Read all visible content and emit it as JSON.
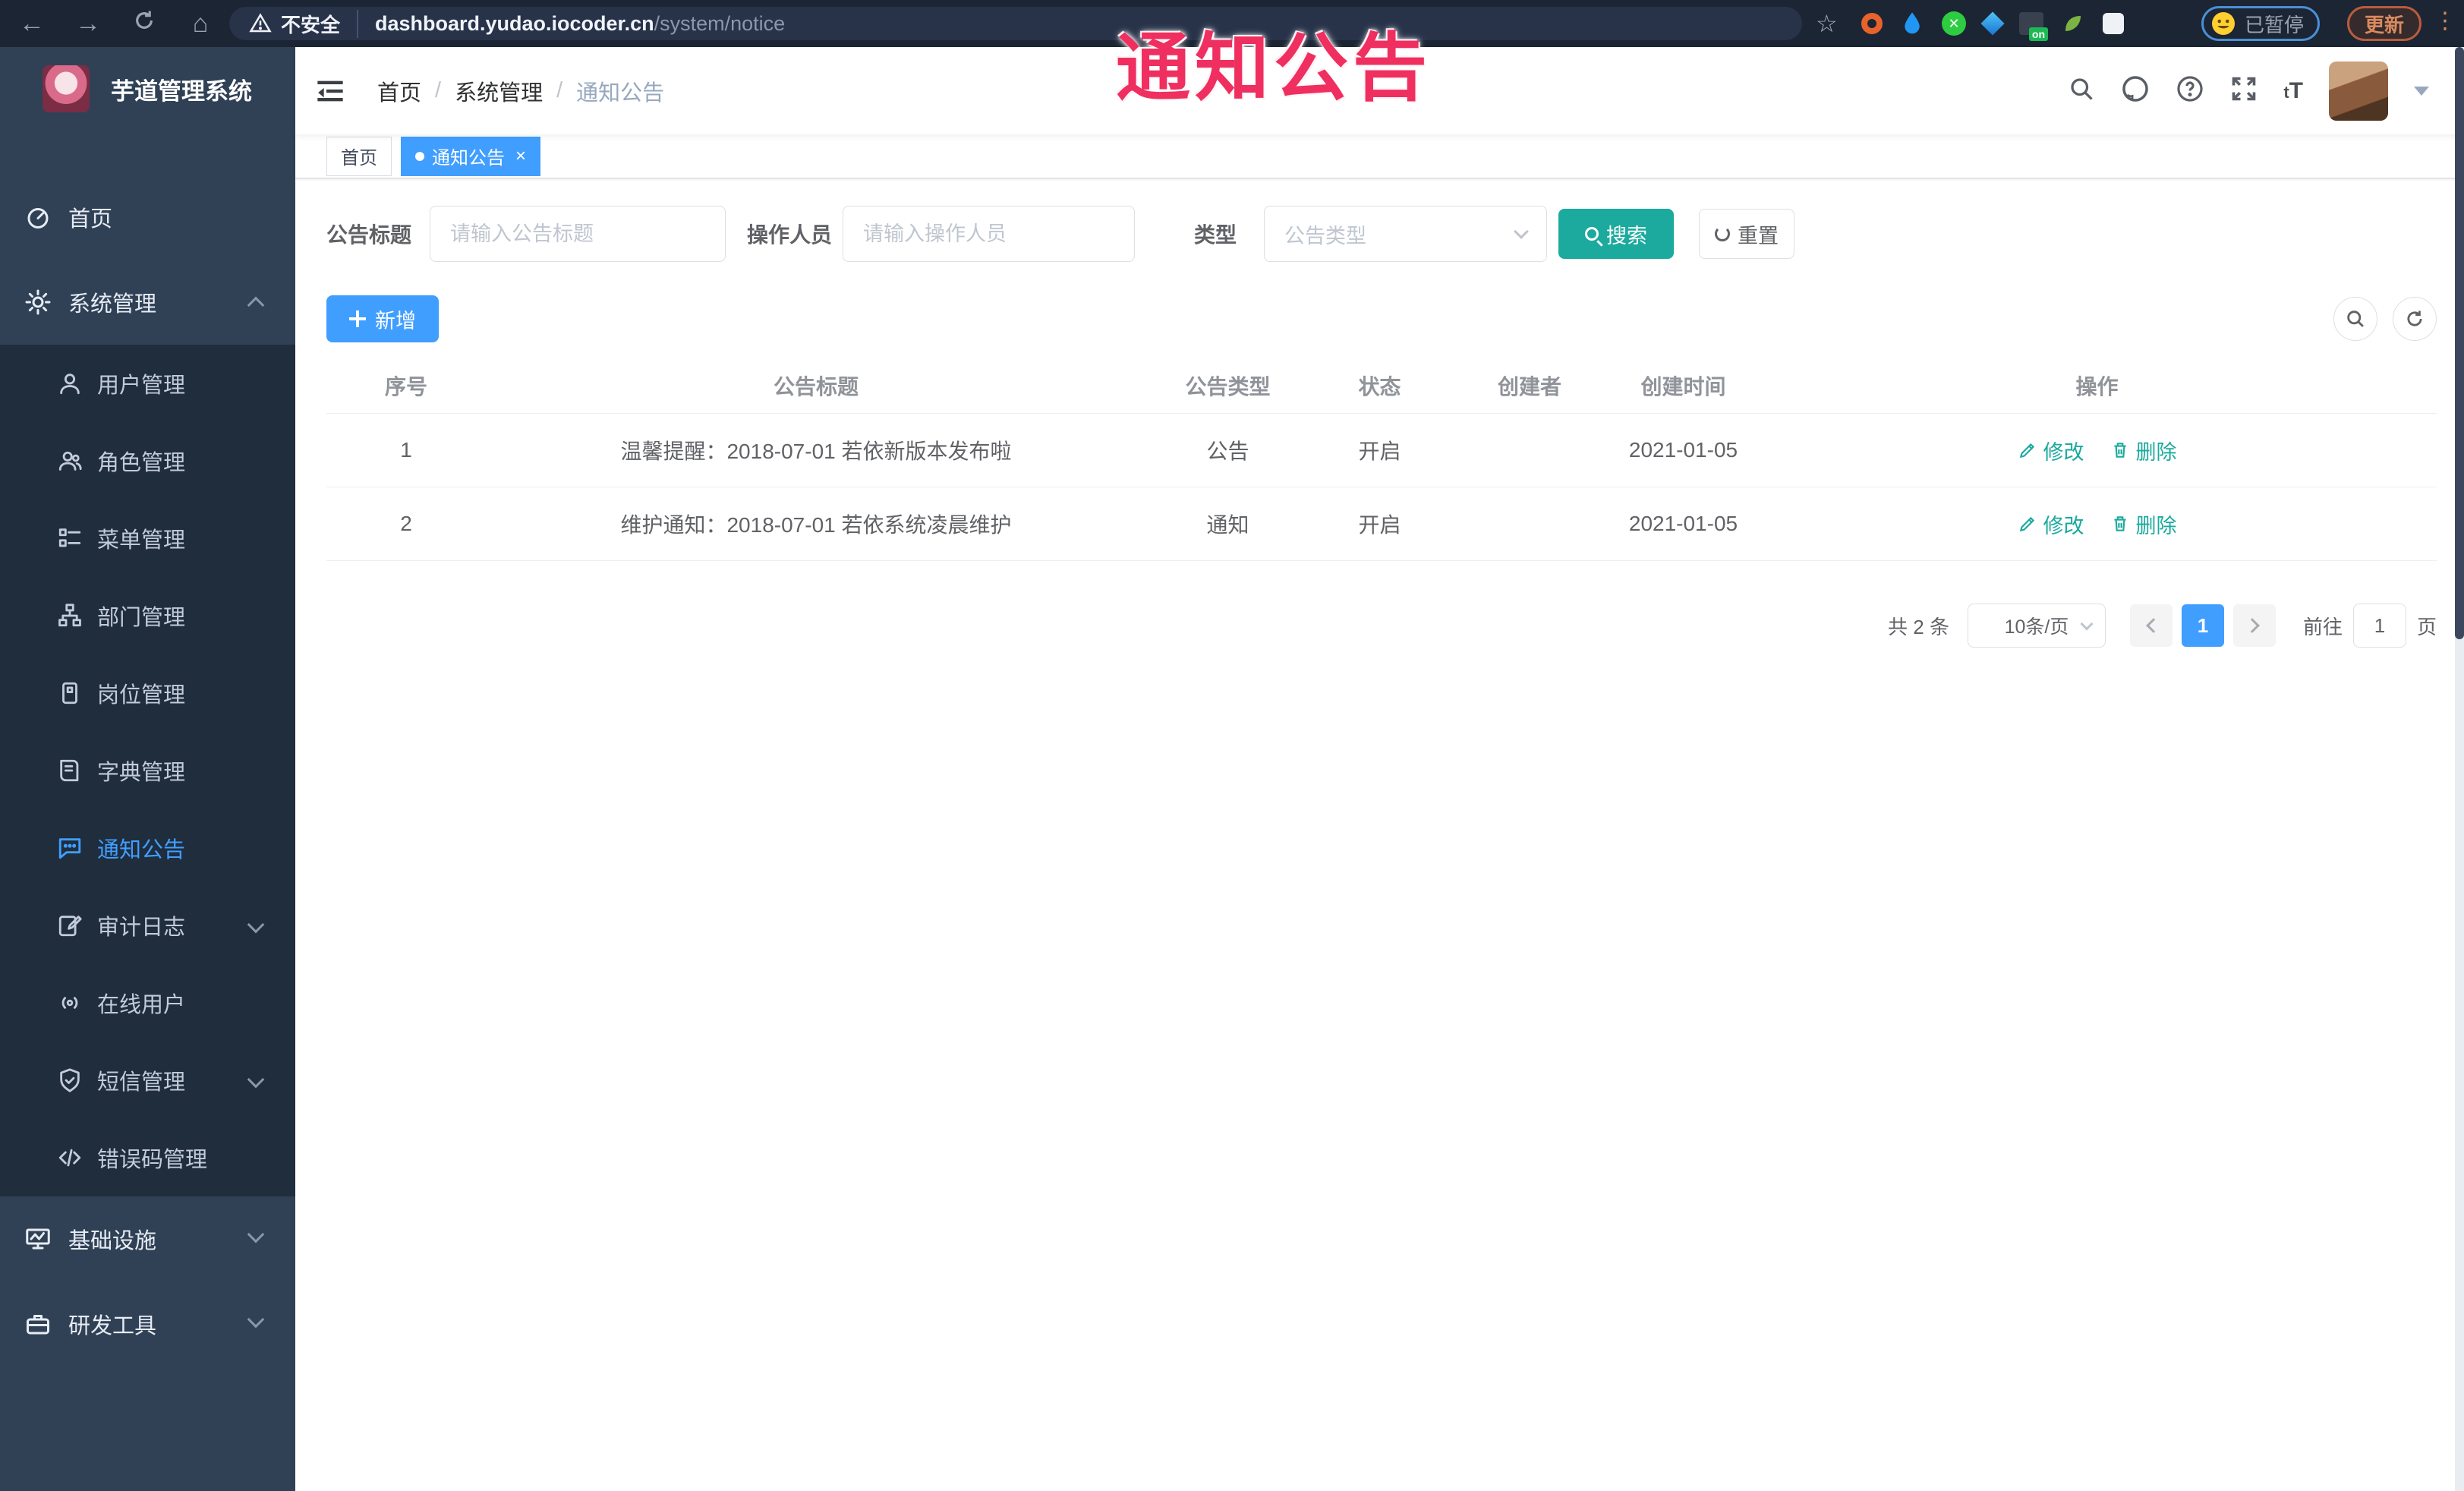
{
  "browser": {
    "security_label": "不安全",
    "url_host": "dashboard.yudao.iocoder.cn",
    "url_path": "/system/notice",
    "paused_label": "已暂停",
    "update_label": "更新",
    "extension_icons": [
      "orange-ring-icon",
      "blue-drop-icon",
      "green-circle-icon",
      "blue-gem-icon",
      "dark-on-icon",
      "green-leaf-icon",
      "puzzle-icon"
    ]
  },
  "watermark": "通知公告",
  "sidebar": {
    "title": "芋道管理系统",
    "items": [
      {
        "label": "首页",
        "icon": "home-icon",
        "level": "top"
      },
      {
        "label": "系统管理",
        "icon": "gear-icon",
        "level": "top",
        "expanded": true
      },
      {
        "label": "用户管理",
        "icon": "user-icon",
        "level": "sub"
      },
      {
        "label": "角色管理",
        "icon": "roles-icon",
        "level": "sub"
      },
      {
        "label": "菜单管理",
        "icon": "menu-list-icon",
        "level": "sub"
      },
      {
        "label": "部门管理",
        "icon": "dept-tree-icon",
        "level": "sub"
      },
      {
        "label": "岗位管理",
        "icon": "post-badge-icon",
        "level": "sub"
      },
      {
        "label": "字典管理",
        "icon": "dict-book-icon",
        "level": "sub"
      },
      {
        "label": "通知公告",
        "icon": "notice-bubble-icon",
        "level": "sub",
        "active": true
      },
      {
        "label": "审计日志",
        "icon": "audit-log-icon",
        "level": "sub",
        "collapsed": true
      },
      {
        "label": "在线用户",
        "icon": "online-user-icon",
        "level": "sub"
      },
      {
        "label": "短信管理",
        "icon": "sms-shield-icon",
        "level": "sub",
        "collapsed": true
      },
      {
        "label": "错误码管理",
        "icon": "error-code-icon",
        "level": "sub"
      },
      {
        "label": "基础设施",
        "icon": "infra-monitor-icon",
        "level": "top",
        "collapsed": true
      },
      {
        "label": "研发工具",
        "icon": "devtool-box-icon",
        "level": "top",
        "collapsed": true
      }
    ]
  },
  "header": {
    "breadcrumb": [
      "首页",
      "系统管理",
      "通知公告"
    ],
    "breadcrumb_separator": "/",
    "font_size_label_small": "t",
    "font_size_label_big": "T",
    "icons": [
      "search-icon",
      "github-icon",
      "help-icon",
      "fullscreen-icon",
      "font-size-icon",
      "avatar",
      "caret-down-icon"
    ]
  },
  "tags": [
    {
      "label": "首页",
      "active": false
    },
    {
      "label": "通知公告",
      "active": true,
      "close_glyph": "×"
    }
  ],
  "filters": {
    "title_label": "公告标题",
    "title_placeholder": "请输入公告标题",
    "operator_label": "操作人员",
    "operator_placeholder": "请输入操作人员",
    "type_label": "类型",
    "type_placeholder": "公告类型",
    "search_label": "搜索",
    "reset_label": "重置"
  },
  "toolbar": {
    "add_label": "新增"
  },
  "table": {
    "columns": [
      "序号",
      "公告标题",
      "公告类型",
      "状态",
      "创建者",
      "创建时间",
      "操作"
    ],
    "edit_label": "修改",
    "delete_label": "删除",
    "rows": [
      {
        "no": "1",
        "title": "温馨提醒：2018-07-01 若依新版本发布啦",
        "type": "公告",
        "status": "开启",
        "creator": "",
        "created": "2021-01-05"
      },
      {
        "no": "2",
        "title": "维护通知：2018-07-01 若依系统凌晨维护",
        "type": "通知",
        "status": "开启",
        "creator": "",
        "created": "2021-01-05"
      }
    ]
  },
  "pagination": {
    "total": "共 2 条",
    "page_size": "10条/页",
    "current_page": "1",
    "goto_label": "前往",
    "goto_value": "1",
    "page_label": "页"
  },
  "colors": {
    "accent_blue": "#409EFF",
    "teal": "#1BAA9D",
    "watermark_pink": "#EF2F5F",
    "sidebar_bg": "#304156",
    "submenu_bg": "#1F2D3D"
  }
}
